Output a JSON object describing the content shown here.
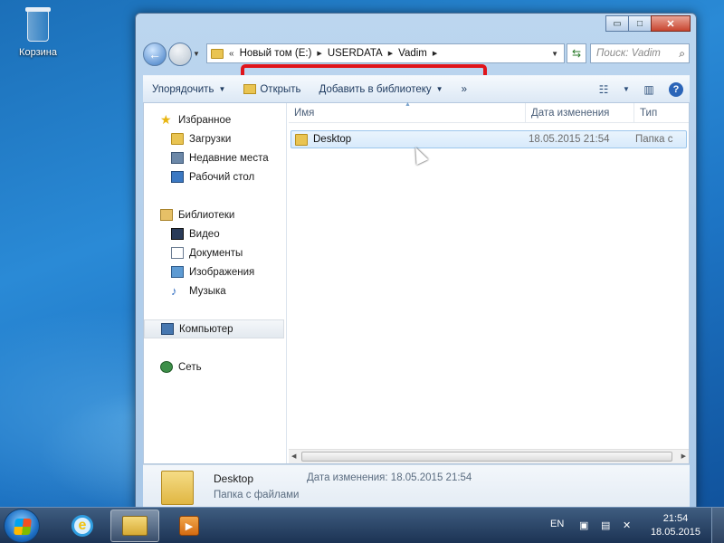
{
  "desktop": {
    "recycle_bin_label": "Корзина"
  },
  "window": {
    "controls": {
      "minimize": "▭",
      "maximize": "□",
      "close": "✕"
    },
    "address": {
      "crumbs": [
        "Новый том (E:)",
        "USERDATA",
        "Vadim"
      ]
    },
    "search": {
      "placeholder": "Поиск: Vadim"
    },
    "toolbar": {
      "organize": "Упорядочить",
      "open": "Открыть",
      "add_to_library": "Добавить в библиотеку",
      "more": "»"
    },
    "nav": {
      "favorites": "Избранное",
      "downloads": "Загрузки",
      "recent": "Недавние места",
      "desktop": "Рабочий стол",
      "libraries": "Библиотеки",
      "videos": "Видео",
      "documents": "Документы",
      "images": "Изображения",
      "music": "Музыка",
      "computer": "Компьютер",
      "network": "Сеть"
    },
    "columns": {
      "name": "Имя",
      "date": "Дата изменения",
      "type": "Тип"
    },
    "files": [
      {
        "name": "Desktop",
        "date": "18.05.2015 21:54",
        "type": "Папка с"
      }
    ],
    "details": {
      "name": "Desktop",
      "type": "Папка с файлами",
      "date_label": "Дата изменения: 18.05.2015 21:54"
    }
  },
  "taskbar": {
    "lang": "EN",
    "time": "21:54",
    "date": "18.05.2015"
  },
  "colors": {
    "highlight_box": "#e0141a",
    "selection": "#d8eafb"
  }
}
